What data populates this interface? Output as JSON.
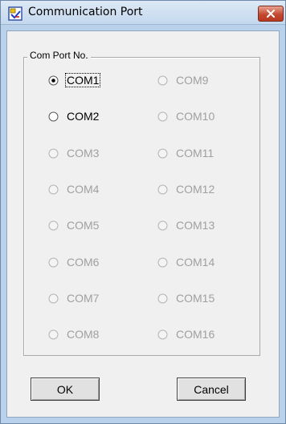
{
  "window": {
    "title": "Communication Port",
    "close_icon": "close-icon",
    "app_icon": "communication-port-app-icon"
  },
  "group": {
    "label": "Com Port No.",
    "selected": "COM1",
    "ports": [
      {
        "label": "COM1",
        "enabled": true,
        "checked": true
      },
      {
        "label": "COM2",
        "enabled": true,
        "checked": false
      },
      {
        "label": "COM3",
        "enabled": false,
        "checked": false
      },
      {
        "label": "COM4",
        "enabled": false,
        "checked": false
      },
      {
        "label": "COM5",
        "enabled": false,
        "checked": false
      },
      {
        "label": "COM6",
        "enabled": false,
        "checked": false
      },
      {
        "label": "COM7",
        "enabled": false,
        "checked": false
      },
      {
        "label": "COM8",
        "enabled": false,
        "checked": false
      },
      {
        "label": "COM9",
        "enabled": false,
        "checked": false
      },
      {
        "label": "COM10",
        "enabled": false,
        "checked": false
      },
      {
        "label": "COM11",
        "enabled": false,
        "checked": false
      },
      {
        "label": "COM12",
        "enabled": false,
        "checked": false
      },
      {
        "label": "COM13",
        "enabled": false,
        "checked": false
      },
      {
        "label": "COM14",
        "enabled": false,
        "checked": false
      },
      {
        "label": "COM15",
        "enabled": false,
        "checked": false
      },
      {
        "label": "COM16",
        "enabled": false,
        "checked": false
      }
    ]
  },
  "buttons": {
    "ok": "OK",
    "cancel": "Cancel"
  },
  "colors": {
    "enabled_text": "#000000",
    "disabled_text": "#a0a0a0",
    "close_button": "#c44a32"
  }
}
